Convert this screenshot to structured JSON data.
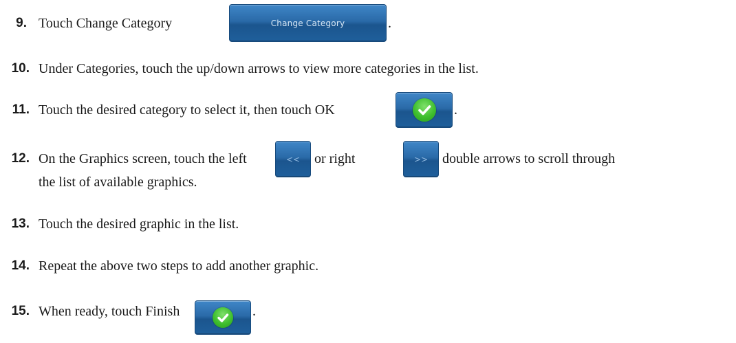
{
  "steps": [
    {
      "num": "9.",
      "before": "Touch Change Category",
      "after": "."
    },
    {
      "num": "10.",
      "text": "Under Categories, touch the up/down arrows to view more categories in the list."
    },
    {
      "num": "11.",
      "before": "Touch the desired category to select it, then touch OK",
      "after": "."
    },
    {
      "num": "12.",
      "before": "On the Graphics screen, touch the left",
      "middle": "or right",
      "after": "double arrows to scroll through",
      "line2": "the list of available graphics."
    },
    {
      "num": "13.",
      "text": "Touch the desired graphic in the list."
    },
    {
      "num": "14.",
      "text": "Repeat the above two steps to add another graphic."
    },
    {
      "num": "15.",
      "before": "When ready, touch Finish",
      "after": "."
    }
  ],
  "buttons": {
    "change_category": "Change Category",
    "left_arrow": "<<",
    "right_arrow": ">>"
  },
  "icons": {
    "ok": "check-icon",
    "finish": "check-icon"
  },
  "colors": {
    "button_blue": "#2a6aa8",
    "check_green": "#3fbf2e"
  }
}
